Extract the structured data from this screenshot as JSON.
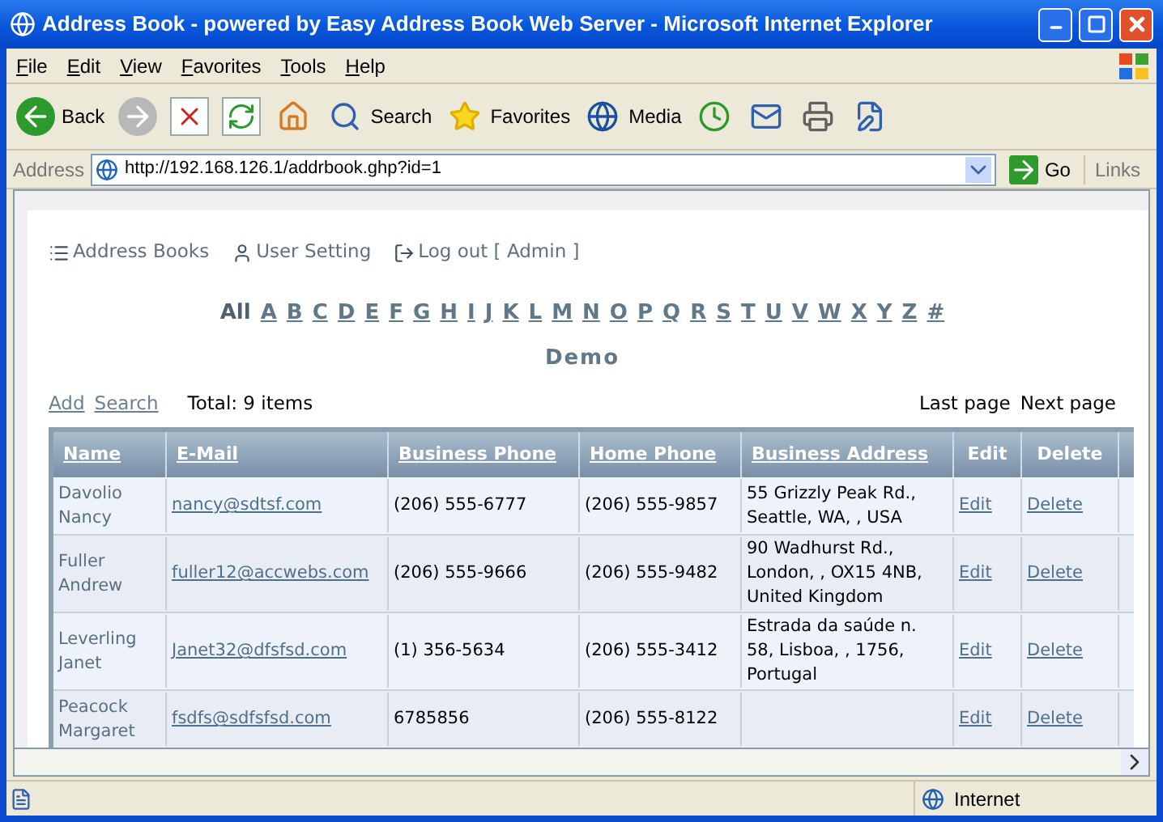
{
  "window": {
    "title": "Address Book - powered by Easy Address Book Web Server - Microsoft Internet Explorer"
  },
  "menu": [
    "File",
    "Edit",
    "View",
    "Favorites",
    "Tools",
    "Help"
  ],
  "toolbar": [
    {
      "kind": "back",
      "label": "Back"
    },
    {
      "kind": "forward"
    },
    {
      "kind": "stop"
    },
    {
      "kind": "refresh"
    },
    {
      "kind": "home"
    },
    {
      "kind": "search",
      "label": "Search"
    },
    {
      "kind": "favorites",
      "label": "Favorites"
    },
    {
      "kind": "media",
      "label": "Media"
    },
    {
      "kind": "history"
    },
    {
      "kind": "mail"
    },
    {
      "kind": "print"
    },
    {
      "kind": "edit"
    }
  ],
  "address_bar": {
    "label": "Address",
    "url": "http://192.168.126.1/addrbook.ghp?id=1",
    "go": "Go",
    "links": "Links"
  },
  "page": {
    "nav": [
      {
        "kind": "books",
        "label": "Address Books"
      },
      {
        "kind": "user",
        "label": "User Setting"
      },
      {
        "kind": "logout",
        "label": "Log out [ Admin ]"
      }
    ],
    "alphabet_all": "All",
    "letters": [
      "A",
      "B",
      "C",
      "D",
      "E",
      "F",
      "G",
      "H",
      "I",
      "J",
      "K",
      "L",
      "M",
      "N",
      "O",
      "P",
      "Q",
      "R",
      "S",
      "T",
      "U",
      "V",
      "W",
      "X",
      "Y",
      "Z",
      "#"
    ],
    "book_title": "Demo",
    "actions": [
      "Add",
      "Search"
    ],
    "total": "Total: 9 items",
    "paging": [
      "Last page",
      "Next page"
    ],
    "table": {
      "columns": [
        {
          "label": "Name",
          "sortable": true
        },
        {
          "label": "E-Mail",
          "sortable": true
        },
        {
          "label": "Business Phone",
          "sortable": true
        },
        {
          "label": "Home Phone",
          "sortable": true
        },
        {
          "label": "Business Address",
          "sortable": true
        },
        {
          "label": "Edit",
          "sortable": false
        },
        {
          "label": "Delete",
          "sortable": false
        }
      ],
      "rows": [
        {
          "name": "Davolio Nancy",
          "email": "nancy@sdtsf.com",
          "business_phone": "(206) 555-6777",
          "home_phone": "(206) 555-9857",
          "business_address": "55 Grizzly Peak Rd., Seattle, WA, , USA",
          "edit": "Edit",
          "delete": "Delete"
        },
        {
          "name": "Fuller Andrew",
          "email": "fuller12@accwebs.com",
          "business_phone": "(206) 555-9666",
          "home_phone": "(206) 555-9482",
          "business_address": "90 Wadhurst Rd., London, , OX15 4NB, United Kingdom",
          "edit": "Edit",
          "delete": "Delete"
        },
        {
          "name": "Leverling Janet",
          "email": "Janet32@dfsfsd.com",
          "business_phone": "(1) 356-5634",
          "home_phone": "(206) 555-3412",
          "business_address": "Estrada da saúde n. 58, Lisboa, , 1756, Portugal",
          "edit": "Edit",
          "delete": "Delete"
        },
        {
          "name": "Peacock Margaret",
          "email": "fsdfs@sdfsfsd.com",
          "business_phone": "6785856",
          "home_phone": "(206) 555-8122",
          "edit": "Edit",
          "delete": "Delete"
        }
      ]
    }
  },
  "status_bar": {
    "zone": "Internet"
  }
}
